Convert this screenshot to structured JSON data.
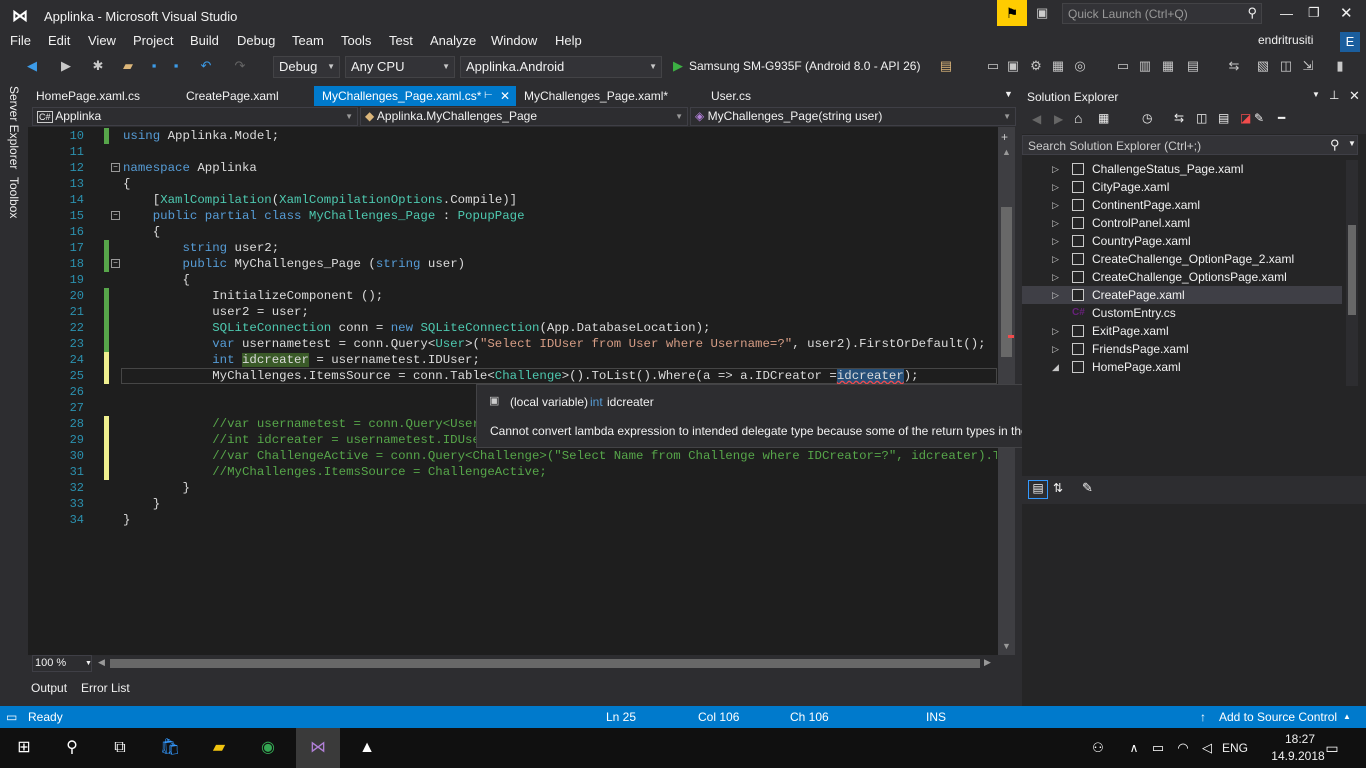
{
  "window": {
    "title": "Applinka - Microsoft Visual Studio",
    "quick_launch_placeholder": "Quick Launch (Ctrl+Q)",
    "user": "endritrusiti",
    "user_initial": "E"
  },
  "menu": [
    "File",
    "Edit",
    "View",
    "Project",
    "Build",
    "Debug",
    "Team",
    "Tools",
    "Test",
    "Analyze",
    "Window",
    "Help"
  ],
  "toolbar": {
    "config": "Debug",
    "platform": "Any CPU",
    "startup_project": "Applinka.Android",
    "device": "Samsung SM-G935F (Android 8.0 - API 26)"
  },
  "left_tabs": [
    "Server Explorer",
    "Toolbox"
  ],
  "doc_tabs": [
    "HomePage.xaml.cs",
    "CreatePage.xaml",
    "MyChallenges_Page.xaml.cs*",
    "MyChallenges_Page.xaml*",
    "User.cs"
  ],
  "nav": {
    "project": "Applinka",
    "class": "Applinka.MyChallenges_Page",
    "member": "MyChallenges_Page(string user)"
  },
  "line_numbers": [
    "10",
    "11",
    "12",
    "13",
    "14",
    "15",
    "16",
    "17",
    "18",
    "19",
    "20",
    "21",
    "22",
    "23",
    "24",
    "25",
    "26",
    "27",
    "28",
    "29",
    "30",
    "31",
    "32",
    "33",
    "34"
  ],
  "code": {
    "l10a": "using",
    "l10b": " Applinka.Model;",
    "l12a": "namespace",
    "l12b": " Applinka",
    "l13": "{",
    "l14a": "    [",
    "l14b": "XamlCompilation",
    "l14c": "(",
    "l14d": "XamlCompilationOptions",
    "l14e": ".Compile)]",
    "l15a": "    public partial class ",
    "l15b": "MyChallenges_Page",
    "l15c": " : ",
    "l15d": "PopupPage",
    "l16": "    {",
    "l17a": "        string",
    "l17b": " user2;",
    "l18a": "        public",
    "l18b": " MyChallenges_Page (",
    "l18c": "string",
    "l18d": " user)",
    "l19": "        {",
    "l20": "            InitializeComponent ();",
    "l21": "            user2 = user;",
    "l22a": "            ",
    "l22b": "SQLiteConnection",
    "l22c": " conn = ",
    "l22d": "new",
    "l22e": " ",
    "l22f": "SQLiteConnection",
    "l22g": "(App.DatabaseLocation);",
    "l23a": "            var",
    "l23b": " usernametest = conn.Query<",
    "l23c": "User",
    "l23d": ">(",
    "l23e": "\"Select IDUser from User where Username=?\"",
    "l23f": ", user2).FirstOrDefault();",
    "l24a": "            int",
    "l24b": " ",
    "l24c": "idcreater",
    "l24d": " = usernametest.IDUser;",
    "l25a": "            MyChallenges.ItemsSource = conn.Table<",
    "l25b": "Challenge",
    "l25c": ">().ToList().Where(a => a.IDCreator =",
    "l25d": "idcreater",
    "l25e": ");",
    "l28": "            //var usernametest = conn.Query<User>(",
    "l29": "            //int idcreater = usernametest.IDUser;",
    "l30": "            //var ChallengeActive = conn.Query<Challenge>(\"Select Name from Challenge where IDCreator=?\", idcreater).ToList()",
    "l31": "            //MyChallenges.ItemsSource = ChallengeActive;",
    "l32": "        }",
    "l33": "    }",
    "l34": "}"
  },
  "tooltip": {
    "kind": "(local variable)",
    "type": "int",
    "name": "idcreater",
    "message": "Cannot convert lambda expression to intended delegate type because some of the return types in the block are not implicitly convertible to the delegate return type"
  },
  "zoom": "100 %",
  "bottom_tabs": [
    "Output",
    "Error List"
  ],
  "solution_explorer": {
    "title": "Solution Explorer",
    "search_placeholder": "Search Solution Explorer (Ctrl+;)",
    "items": [
      "ChallengeStatus_Page.xaml",
      "CityPage.xaml",
      "ContinentPage.xaml",
      "ControlPanel.xaml",
      "CountryPage.xaml",
      "CreateChallenge_OptionPage_2.xaml",
      "CreateChallenge_OptionsPage.xaml",
      "CreatePage.xaml",
      "CustomEntry.cs",
      "ExitPage.xaml",
      "FriendsPage.xaml",
      "HomePage.xaml"
    ],
    "selected": "CreatePage.xaml"
  },
  "status": {
    "ready": "Ready",
    "ln": "Ln 25",
    "col": "Col 106",
    "ch": "Ch 106",
    "ins": "INS",
    "source_control": "Add to Source Control"
  },
  "taskbar": {
    "lang": "ENG",
    "time": "18:27",
    "date": "14.9.2018"
  },
  "colors": {
    "accent": "#007acc",
    "editor_bg": "#1e1e1e",
    "chrome_bg": "#2d2d30"
  }
}
